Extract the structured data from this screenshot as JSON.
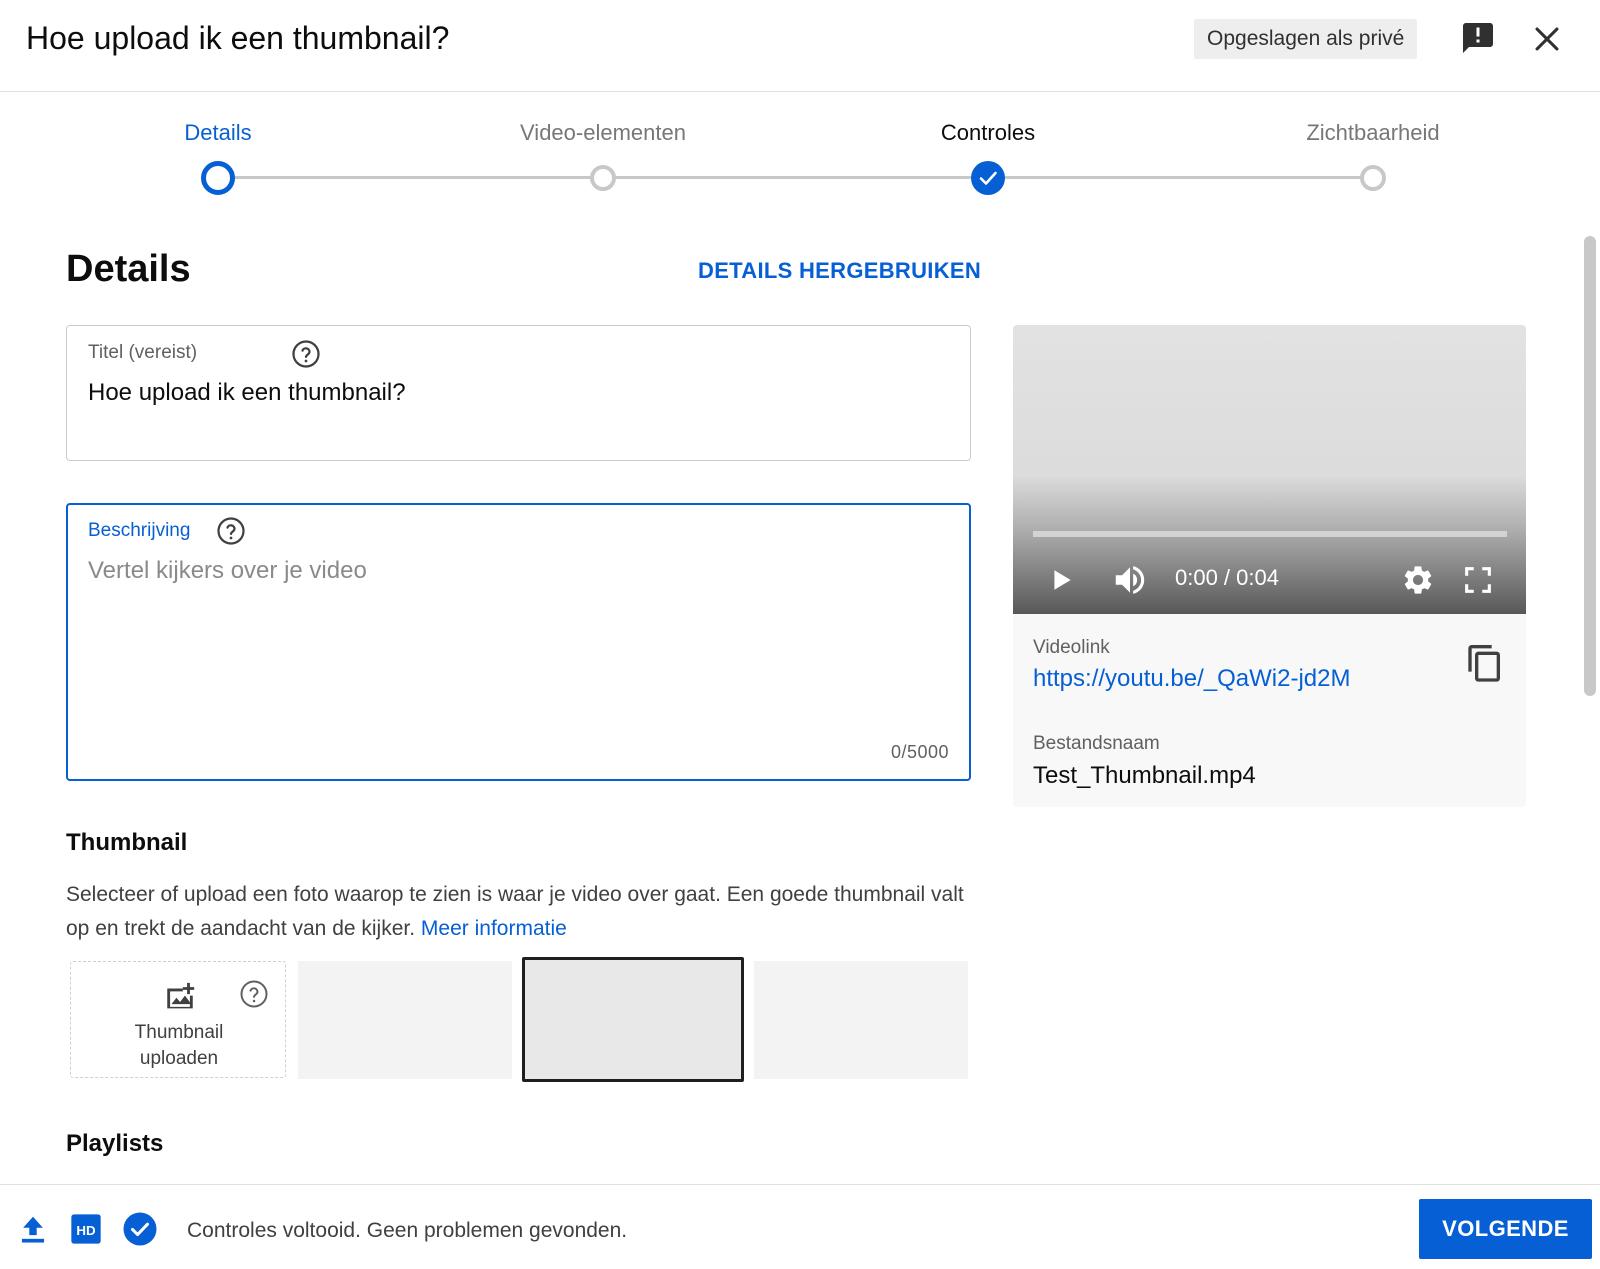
{
  "dialog": {
    "title": "Hoe upload ik een thumbnail?",
    "saved_badge": "Opgeslagen als privé",
    "icons": {
      "feedback": "feedback-icon",
      "close": "close-icon"
    }
  },
  "stepper": {
    "steps": [
      {
        "label": "Details",
        "state": "active"
      },
      {
        "label": "Video-elementen",
        "state": "pending"
      },
      {
        "label": "Controles",
        "state": "completed"
      },
      {
        "label": "Zichtbaarheid",
        "state": "pending"
      }
    ]
  },
  "details": {
    "heading": "Details",
    "reuse_link": "DETAILS HERGEBRUIKEN",
    "title_field": {
      "label": "Titel (vereist)",
      "value": "Hoe upload ik een thumbnail?"
    },
    "description_field": {
      "label": "Beschrijving",
      "placeholder": "Vertel kijkers over je video",
      "char_count": "0/5000"
    }
  },
  "thumbnail": {
    "heading": "Thumbnail",
    "description": "Selecteer of upload een foto waarop te zien is waar je video over gaat. Een goede thumbnail valt op en trekt de aandacht van de kijker.",
    "learn_more": "Meer informatie",
    "upload_label_line1": "Thumbnail",
    "upload_label_line2": "uploaden",
    "options_count": 3,
    "selected_index": 1
  },
  "playlists": {
    "heading": "Playlists"
  },
  "video": {
    "time": "0:00 / 0:04",
    "progress": 0,
    "link_label": "Videolink",
    "link_url": "https://youtu.be/_QaWi2-jd2M",
    "filename_label": "Bestandsnaam",
    "filename": "Test_Thumbnail.mp4"
  },
  "footer": {
    "status_text": "Controles voltooid. Geen problemen gevonden.",
    "next_button": "VOLGENDE",
    "icons": [
      "upload-icon",
      "hd-icon",
      "check-circle-icon"
    ]
  },
  "colors": {
    "accent": "#065fd4",
    "step_inactive": "#c8c8c8",
    "text_primary": "#0d0d0d",
    "text_secondary": "#606060"
  }
}
